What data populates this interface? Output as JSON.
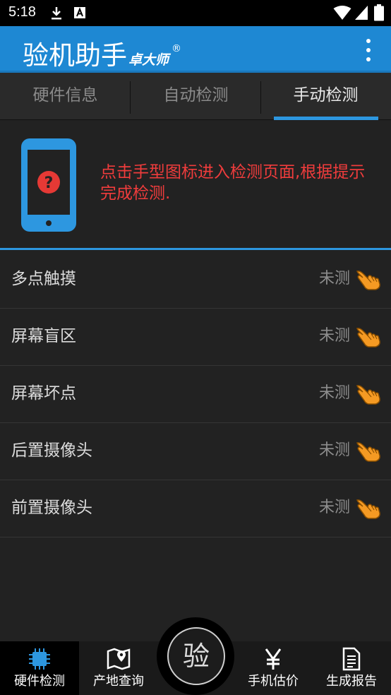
{
  "status_bar": {
    "time": "5:18",
    "icons": [
      "download-icon",
      "text-app-icon",
      "wifi-icon",
      "signal-icon",
      "battery-icon"
    ]
  },
  "app_bar": {
    "title": "验机助手",
    "subtitle": "卓大师",
    "registered_mark": "®",
    "menu_icon": "more-vert-icon"
  },
  "tabs": [
    {
      "label": "硬件信息",
      "active": false
    },
    {
      "label": "自动检测",
      "active": false
    },
    {
      "label": "手动检测",
      "active": true
    }
  ],
  "hint": {
    "icon": "phone-question-icon",
    "text": "点击手型图标进入检测页面,根据提示完成检测."
  },
  "tests": [
    {
      "label": "多点触摸",
      "status": "未测",
      "icon": "hand-pointer-icon"
    },
    {
      "label": "屏幕盲区",
      "status": "未测",
      "icon": "hand-pointer-icon"
    },
    {
      "label": "屏幕坏点",
      "status": "未测",
      "icon": "hand-pointer-icon"
    },
    {
      "label": "后置摄像头",
      "status": "未测",
      "icon": "hand-pointer-icon"
    },
    {
      "label": "前置摄像头",
      "status": "未测",
      "icon": "hand-pointer-icon"
    }
  ],
  "bottom_nav": {
    "items": [
      {
        "label": "硬件检测",
        "icon": "chip-icon",
        "active": true
      },
      {
        "label": "产地查询",
        "icon": "map-pin-icon",
        "active": false
      },
      {
        "label": "手机估价",
        "icon": "yen-icon",
        "active": false
      },
      {
        "label": "生成报告",
        "icon": "document-icon",
        "active": false
      }
    ],
    "center_button": "验"
  },
  "colors": {
    "accent": "#1e88d3",
    "hint_text": "#f03c3c",
    "background": "#222222",
    "hand_icon": "#f59a23"
  }
}
